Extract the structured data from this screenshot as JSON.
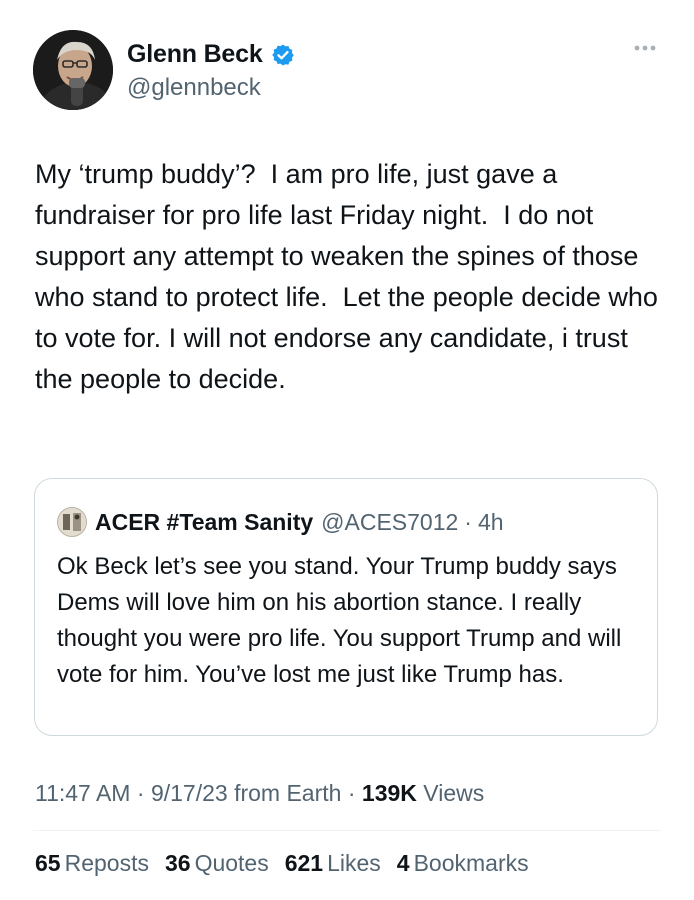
{
  "author": {
    "display_name": "Glenn Beck",
    "handle": "@glennbeck",
    "verified_icon": "verified-badge-icon",
    "verified_color": "#1d9bf0"
  },
  "more_menu_icon": "more-dots-icon",
  "tweet": {
    "text": "My ‘trump buddy’?  I am pro life, just gave a fundraiser for pro life last Friday night.  I do not support any attempt to weaken the spines of those who stand to protect life.  Let the people decide who to vote for. I will not endorse any candidate, i trust the people to decide."
  },
  "quoted_tweet": {
    "display_name": "ACER #Team Sanity",
    "handle": "@ACES7012",
    "separator": "·",
    "time": "4h",
    "text": "Ok Beck let’s see you stand. Your Trump buddy says Dems will love him on his abortion stance. I really thought you were pro life. You support Trump and will vote for him. You’ve lost me just like Trump has."
  },
  "meta": {
    "time": "11:47 AM",
    "sep1": "·",
    "date": "9/17/23",
    "source": "from Earth",
    "sep2": "·",
    "views_count": "139K",
    "views_label": "Views"
  },
  "stats": [
    {
      "count": "65",
      "label": "Reposts"
    },
    {
      "count": "36",
      "label": "Quotes"
    },
    {
      "count": "621",
      "label": "Likes"
    },
    {
      "count": "4",
      "label": "Bookmarks"
    }
  ],
  "colors": {
    "text_primary": "#0f1419",
    "text_secondary": "#536471",
    "border": "#cfd9de"
  }
}
